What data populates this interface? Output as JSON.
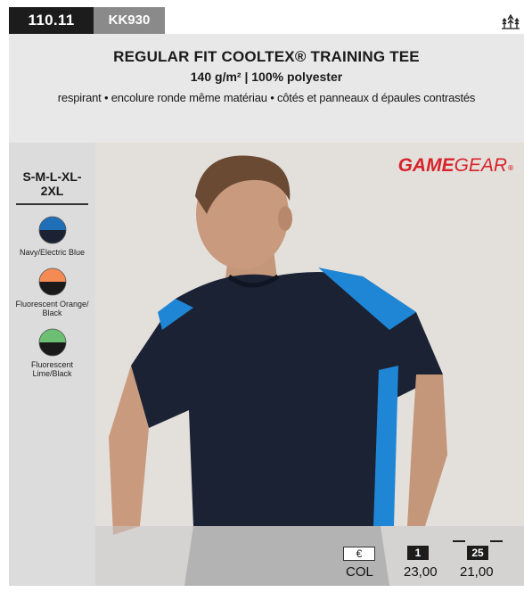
{
  "header": {
    "ref_code": "110.11",
    "model_code": "KK930",
    "tree_icon": "eco-tree-icon"
  },
  "product": {
    "title": "REGULAR FIT COOLTEX® TRAINING TEE",
    "subtitle": "140 g/m² | 100% polyester",
    "features": "respirant • encolure ronde même matériau • côtés et panneaux d épaules contrastés"
  },
  "sizes": "S-M-L-XL-2XL",
  "swatches": [
    {
      "label": "Navy/Electric Blue",
      "top": "#1f6fb8",
      "bottom": "#1b2233"
    },
    {
      "label": "Fluorescent Orange/ Black",
      "top": "#f58b54",
      "bottom": "#1a1a1a"
    },
    {
      "label": "Fluorescent Lime/Black",
      "top": "#6dbf73",
      "bottom": "#1a1a1a"
    }
  ],
  "brand": {
    "part1": "GAME",
    "part2": "GEAR",
    "reg": "®",
    "color": "#d8232a"
  },
  "pricing": {
    "currency_label": "€",
    "row_label": "COL",
    "tiers": [
      {
        "qty": "1",
        "price": "23,00"
      },
      {
        "qty": "25",
        "price": "21,00"
      }
    ]
  },
  "colors": {
    "navy": "#1b2233",
    "electric_blue": "#1f86d6",
    "skin": "#c99a7e"
  }
}
